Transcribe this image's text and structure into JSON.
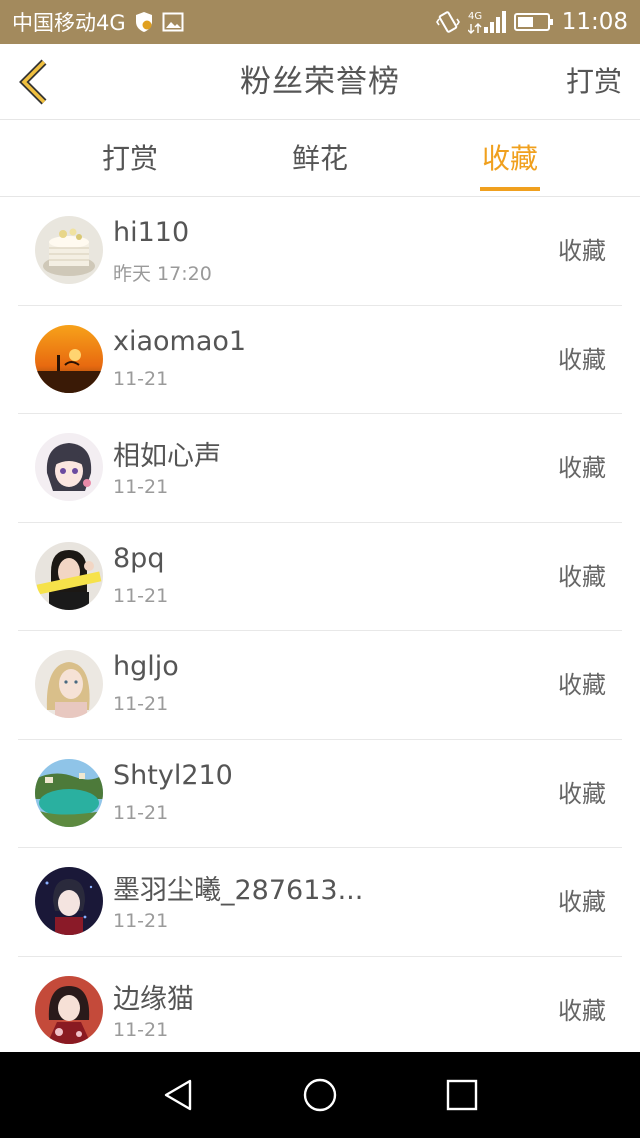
{
  "status_bar": {
    "carrier": "中国移动4G",
    "network": "4G",
    "time": "11:08"
  },
  "header": {
    "title": "粉丝荣誉榜",
    "action": "打赏"
  },
  "tabs": [
    {
      "label": "打赏",
      "active": false
    },
    {
      "label": "鲜花",
      "active": false
    },
    {
      "label": "收藏",
      "active": true
    }
  ],
  "accent_color": "#f0a01e",
  "list": [
    {
      "name": "hi110",
      "date": "昨天 17:20",
      "action": "收藏",
      "avatar": "cake-avatar"
    },
    {
      "name": "xiaomao1",
      "date": "11-21",
      "action": "收藏",
      "avatar": "sunset-avatar"
    },
    {
      "name": "相如心声",
      "date": "11-21",
      "action": "收藏",
      "avatar": "anime-girl-avatar"
    },
    {
      "name": "8pq",
      "date": "11-21",
      "action": "收藏",
      "avatar": "girl-photo-avatar"
    },
    {
      "name": "hgljo",
      "date": "11-21",
      "action": "收藏",
      "avatar": "blonde-woman-avatar"
    },
    {
      "name": "Shtyl210",
      "date": "11-21",
      "action": "收藏",
      "avatar": "lagoon-avatar"
    },
    {
      "name": "墨羽尘曦_287613...",
      "date": "11-21",
      "action": "收藏",
      "avatar": "anime-boy-avatar"
    },
    {
      "name": "边缘猫",
      "date": "11-21",
      "action": "收藏",
      "avatar": "kimono-anime-avatar"
    }
  ]
}
